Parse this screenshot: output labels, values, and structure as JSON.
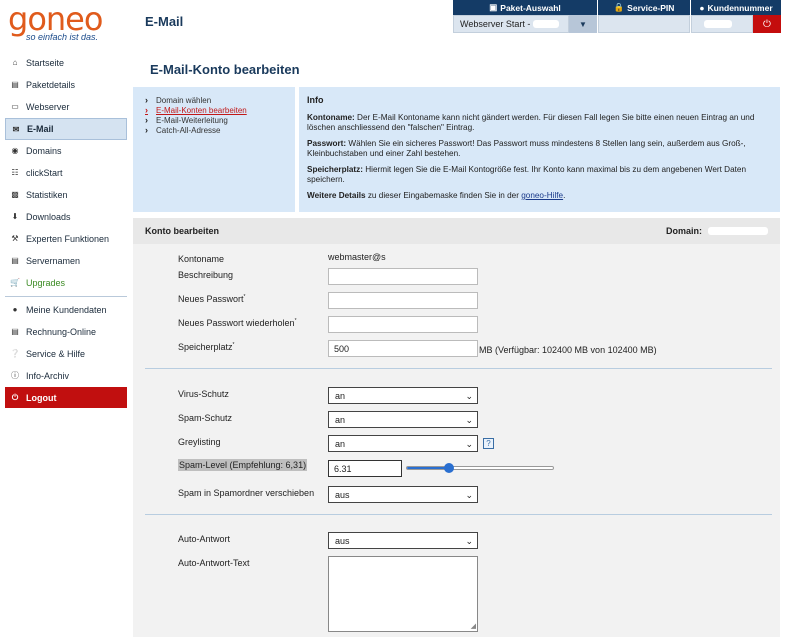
{
  "logo": {
    "word": "goneo",
    "tagline": "so einfach ist das."
  },
  "header": {
    "title": "E-Mail"
  },
  "topbar": {
    "paket_label": "Paket-Auswahl",
    "pin_label": "Service-PIN",
    "kunde_label": "Kundennummer",
    "webserver_value": "Webserver Start -"
  },
  "sidebar": {
    "items": [
      {
        "label": "Startseite",
        "icon": "home-icon"
      },
      {
        "label": "Paketdetails",
        "icon": "list-icon"
      },
      {
        "label": "Webserver",
        "icon": "server-icon"
      },
      {
        "label": "E-Mail",
        "icon": "mail-icon"
      },
      {
        "label": "Domains",
        "icon": "globe-icon"
      },
      {
        "label": "clickStart",
        "icon": "apps-icon"
      },
      {
        "label": "Statistiken",
        "icon": "stats-icon"
      },
      {
        "label": "Downloads",
        "icon": "download-icon"
      },
      {
        "label": "Experten Funktionen",
        "icon": "wrench-icon"
      },
      {
        "label": "Servernamen",
        "icon": "servernames-icon"
      },
      {
        "label": "Upgrades",
        "icon": "cart-icon"
      },
      {
        "label": "Meine Kundendaten",
        "icon": "user-icon"
      },
      {
        "label": "Rechnung-Online",
        "icon": "invoice-icon"
      },
      {
        "label": "Service & Hilfe",
        "icon": "help-icon"
      },
      {
        "label": "Info-Archiv",
        "icon": "info-icon"
      },
      {
        "label": "Logout",
        "icon": "power-icon"
      }
    ]
  },
  "main": {
    "title": "E-Mail-Konto bearbeiten",
    "steps": [
      "Domain wählen",
      "E-Mail-Konten bearbeiten",
      "E-Mail-Weiterleitung",
      "Catch-All-Adresse"
    ],
    "info": {
      "heading": "Info",
      "p1_bold": "Kontoname:",
      "p1_text": " Der E-Mail Kontoname kann nicht gändert werden. Für diesen Fall legen Sie bitte einen neuen Eintrag an und löschen anschliessend den \"falschen\" Eintrag.",
      "p2_bold": "Passwort:",
      "p2_text": " Wählen Sie ein sicheres Passwort! Das Passwort muss mindestens 8 Stellen lang sein, außerdem aus Groß-, Kleinbuchstaben und einer Zahl bestehen.",
      "p3_bold": "Speicherplatz:",
      "p3_text": " Hiermit legen Sie die E-Mail Kontogröße fest. Ihr Konto kann maximal bis zu dem angebenen Wert Daten speichern.",
      "p4_bold": "Weitere Details",
      "p4_text": " zu dieser Eingabemaske finden Sie in der ",
      "p4_link": "goneo-Hilfe",
      "p4_end": "."
    },
    "form": {
      "head_title": "Konto bearbeiten",
      "domain_label": "Domain:",
      "kontoname_label": "Kontoname",
      "kontoname_value": "webmaster@s",
      "beschreibung_label": "Beschreibung",
      "neues_passwort_label": "Neues Passwort",
      "passwort_wdh_label": "Neues Passwort wiederholen",
      "speicherplatz_label": "Speicherplatz",
      "speicherplatz_value": "500",
      "speicherplatz_hint": "MB (Verfügbar: 102400 MB von 102400 MB)",
      "virus_label": "Virus-Schutz",
      "virus_value": "an",
      "spam_label": "Spam-Schutz",
      "spam_value": "an",
      "grey_label": "Greylisting",
      "grey_value": "an",
      "help_glyph": "?",
      "spamlevel_label": "Spam-Level (Empfehlung: 6,31)",
      "spamlevel_value": "6.31",
      "spamlevel_slider_fraction": 0.29,
      "spamordner_label": "Spam in Spamordner verschieben",
      "spamordner_value": "aus",
      "autoantwort_label": "Auto-Antwort",
      "autoantwort_value": "aus",
      "autoantwort_text_label": "Auto-Antwort-Text"
    }
  }
}
